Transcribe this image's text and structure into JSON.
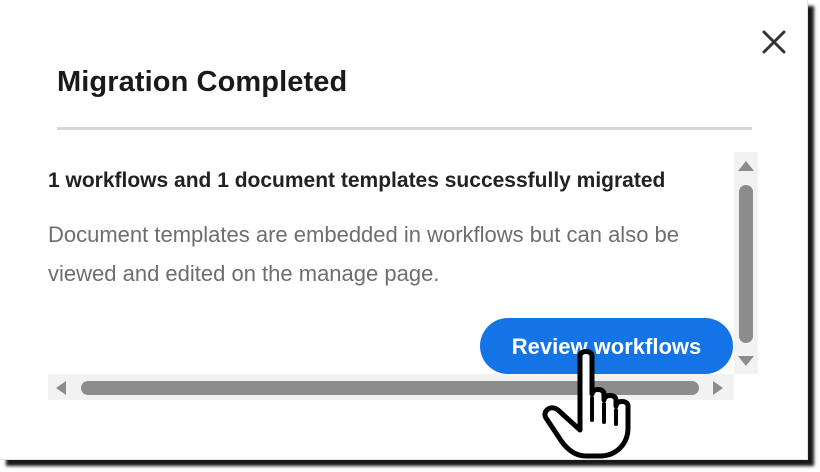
{
  "dialog": {
    "title": "Migration Completed",
    "close_icon": "close-icon",
    "message_heading": "1 workflows and 1 document templates successfully migrated",
    "message_body": "Document templates are embedded in workflows but can also be viewed and edited on the manage page.",
    "review_button_label": "Review workflows"
  },
  "colors": {
    "primary_button": "#1473e6",
    "title_text": "#1a1a1a",
    "body_text": "#6e6e6e",
    "scrollbar": "#8c8c8c"
  },
  "icons": {
    "cursor": "hand-pointer-icon",
    "scroll_up": "arrow-up-icon",
    "scroll_down": "arrow-down-icon",
    "scroll_left": "arrow-left-icon",
    "scroll_right": "arrow-right-icon"
  }
}
